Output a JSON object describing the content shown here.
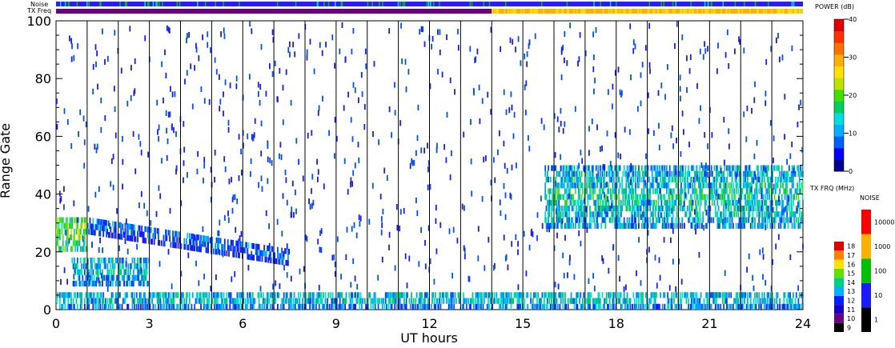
{
  "chart_data": {
    "type": "heatmap",
    "xlabel": "UT hours",
    "ylabel": "Range Gate",
    "xlim": [
      0,
      24
    ],
    "ylim": [
      0,
      100
    ],
    "x_ticks": [
      "0",
      "3",
      "6",
      "9",
      "12",
      "15",
      "18",
      "21",
      "24"
    ],
    "y_ticks": [
      "0",
      "20",
      "40",
      "60",
      "80",
      "100"
    ],
    "hour_lines": [
      1,
      2,
      3,
      4,
      5,
      6,
      7,
      8,
      9,
      10,
      11,
      12,
      13,
      14,
      15,
      16,
      17,
      18,
      19,
      20,
      21,
      22,
      23
    ],
    "status_bars": {
      "noise_label": "Noise",
      "txfreq_label": "TX Freq",
      "txfreq_change_hour": 14
    },
    "power_scale": {
      "title": "POWER (dB)",
      "ticks": [
        "0",
        "10",
        "20",
        "30",
        "40"
      ],
      "range": [
        0,
        40
      ]
    },
    "tx_freq_scale": {
      "title": "TX FRQ (MHz)",
      "ticks": [
        "9",
        "10",
        "11",
        "12",
        "13",
        "14",
        "15",
        "16",
        "17",
        "18"
      ],
      "colors": [
        "#000000",
        "#6a0080",
        "#1a00c0",
        "#0020ff",
        "#00b0ff",
        "#00d080",
        "#60e000",
        "#ffe000",
        "#ff8000",
        "#e00000"
      ]
    },
    "noise_scale": {
      "title": "NOISE",
      "ticks": [
        "1",
        "10",
        "100",
        "1000",
        "10000"
      ],
      "colors": [
        "#000000",
        "#1a1aff",
        "#00c000",
        "#ffb000",
        "#ff0000"
      ]
    },
    "echo_bands": [
      {
        "name": "ground-scatter",
        "x_start": 0,
        "x_end": 24,
        "gate_lo": 0,
        "gate_hi": 6,
        "power": 14
      },
      {
        "name": "early-band-upper",
        "x_start": 0,
        "x_end": 1,
        "gate_lo": 20,
        "gate_hi": 32,
        "power": 22
      },
      {
        "name": "descending-band",
        "x_start": 1,
        "x_end": 7.5,
        "gate_lo_start": 26,
        "gate_lo_end": 15,
        "width": 6,
        "power": 8
      },
      {
        "name": "mid-band",
        "x_start": 0.5,
        "x_end": 3,
        "gate_lo": 8,
        "gate_hi": 18,
        "power": 14
      },
      {
        "name": "evening-band",
        "x_start": 15.7,
        "x_end": 24,
        "gate_lo": 28,
        "gate_hi": 50,
        "power": 16
      }
    ]
  },
  "colors": {
    "power": [
      "#1a1aff",
      "#0050ff",
      "#00a0ff",
      "#00e0d0",
      "#00d060",
      "#60e000",
      "#e0e000",
      "#ffb000",
      "#ff6000",
      "#e00000"
    ],
    "grid": "#000000"
  }
}
